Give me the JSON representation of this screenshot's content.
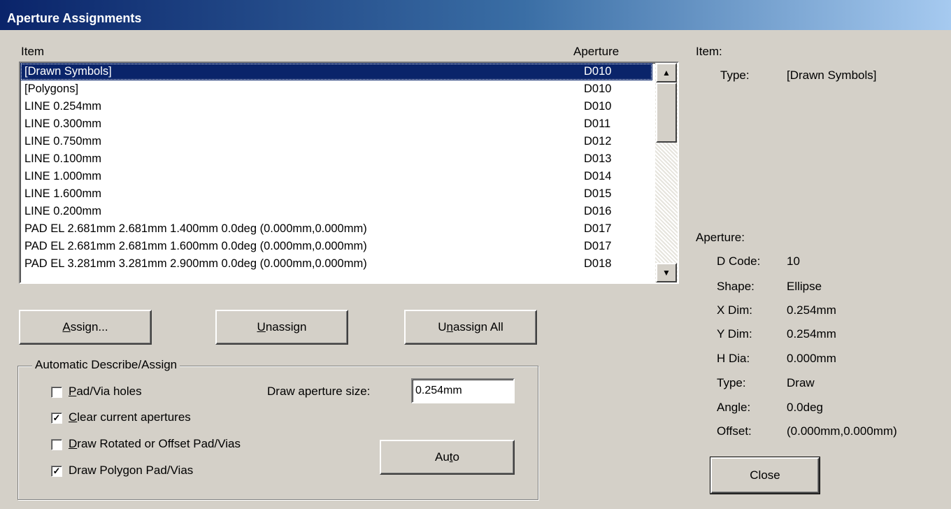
{
  "window": {
    "title": "Aperture Assignments"
  },
  "list": {
    "col_item": "Item",
    "col_aperture": "Aperture",
    "rows": [
      {
        "item": "[Drawn Symbols]",
        "aperture": "D010"
      },
      {
        "item": "[Polygons]",
        "aperture": "D010"
      },
      {
        "item": "LINE 0.254mm",
        "aperture": "D010"
      },
      {
        "item": "LINE 0.300mm",
        "aperture": "D011"
      },
      {
        "item": "LINE 0.750mm",
        "aperture": "D012"
      },
      {
        "item": "LINE 0.100mm",
        "aperture": "D013"
      },
      {
        "item": "LINE 1.000mm",
        "aperture": "D014"
      },
      {
        "item": "LINE 1.600mm",
        "aperture": "D015"
      },
      {
        "item": "LINE 0.200mm",
        "aperture": "D016"
      },
      {
        "item": "PAD EL 2.681mm 2.681mm 1.400mm 0.0deg (0.000mm,0.000mm)",
        "aperture": "D017"
      },
      {
        "item": "PAD EL 2.681mm 2.681mm 1.600mm 0.0deg (0.000mm,0.000mm)",
        "aperture": "D017"
      },
      {
        "item": "PAD EL 3.281mm 3.281mm 2.900mm 0.0deg (0.000mm,0.000mm)",
        "aperture": "D018"
      }
    ],
    "selected_index": 0,
    "scroll_up_icon": "triangle-up-icon",
    "scroll_down_icon": "triangle-down-icon"
  },
  "buttons": {
    "assign_pre": "",
    "assign_u": "A",
    "assign_post": "ssign...",
    "unassign_pre": "",
    "unassign_u": "U",
    "unassign_post": "nassign",
    "unassign_all_pre": "U",
    "unassign_all_u": "n",
    "unassign_all_post": "assign All",
    "auto_pre": "Au",
    "auto_u": "t",
    "auto_post": "o",
    "close": "Close"
  },
  "auto_group": {
    "label": "Automatic Describe/Assign",
    "pad_via_holes": {
      "pre": "",
      "u": "P",
      "post": "ad/Via holes",
      "checked": false
    },
    "clear_current": {
      "pre": "",
      "u": "C",
      "post": "lear current apertures",
      "checked": true
    },
    "draw_rotated": {
      "pre": "",
      "u": "D",
      "post": "raw Rotated or Offset Pad/Vias",
      "checked": false
    },
    "draw_polygon": {
      "pre": "",
      "u": "",
      "post": "Draw Polygon Pad/Vias",
      "checked": true
    },
    "draw_size_label": "Draw aperture size:",
    "draw_size_value": "0.254mm"
  },
  "item_info": {
    "heading": "Item:",
    "type_label": "Type:",
    "type_value": "[Drawn Symbols]"
  },
  "aperture_info": {
    "heading": "Aperture:",
    "fields": [
      {
        "label": "D Code:",
        "value": "10"
      },
      {
        "label": "Shape:",
        "value": "Ellipse"
      },
      {
        "label": "X Dim:",
        "value": "0.254mm"
      },
      {
        "label": "Y Dim:",
        "value": "0.254mm"
      },
      {
        "label": "H Dia:",
        "value": "0.000mm"
      },
      {
        "label": "Type:",
        "value": "Draw"
      },
      {
        "label": "Angle:",
        "value": "0.0deg"
      },
      {
        "label": "Offset:",
        "value": "(0.000mm,0.000mm)"
      }
    ]
  },
  "check_mark": "✓"
}
